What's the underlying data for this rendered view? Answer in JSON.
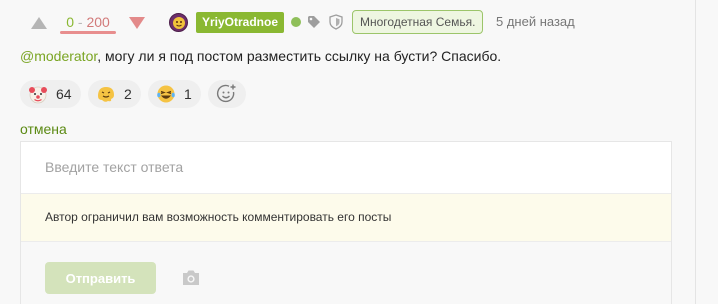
{
  "rating": {
    "plus": "0",
    "separator": "-",
    "minus": "200",
    "positive_share": 0
  },
  "author": {
    "username": "YriyOtradnoe",
    "online": true,
    "badge": "Многодетная Семья."
  },
  "timestamp": "5 дней назад",
  "comment": {
    "mention": "@moderator",
    "text": ", могу ли я под постом разместить ссылку на бусти? Спасибо."
  },
  "reactions": [
    {
      "icon": "clown-face-emoji-icon",
      "count": "64"
    },
    {
      "icon": "melting-face-emoji-icon",
      "count": "2"
    },
    {
      "icon": "laughing-tears-emoji-icon",
      "count": "1"
    }
  ],
  "add_reaction_icon": "add-reaction-icon",
  "cancel_label": "отмена",
  "reply": {
    "placeholder": "Введите текст ответа",
    "restriction_notice": "Автор ограничил вам возможность комментировать его посты",
    "send_label": "Отправить",
    "attach_icon": "camera-icon"
  },
  "colors": {
    "accent_green": "#8ab832",
    "link_green": "#5b8a13",
    "downvote_red": "#e88e8e",
    "notice_bg": "#fdfbeb"
  }
}
